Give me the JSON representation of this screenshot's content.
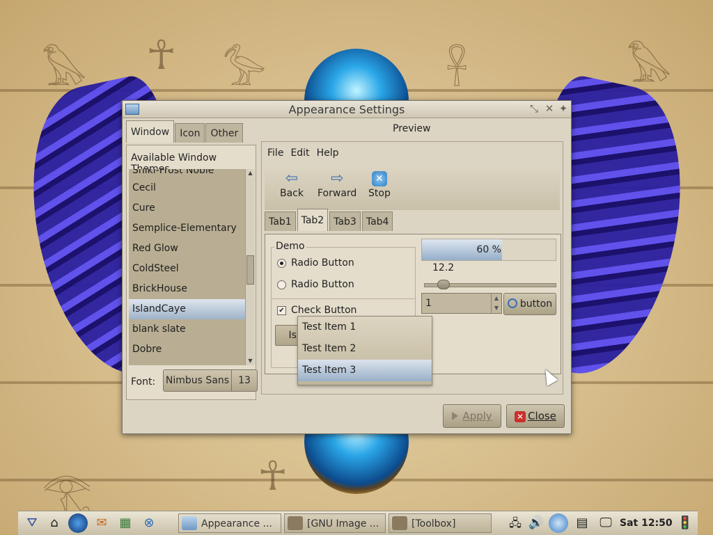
{
  "window": {
    "title": "Appearance Settings",
    "tabs": [
      {
        "label": "Window",
        "active": true
      },
      {
        "label": "Icon",
        "active": false
      },
      {
        "label": "Other",
        "active": false
      }
    ],
    "themes_heading": "Available Window Themes",
    "themes": [
      "Shiki-Frost Noble",
      "Cecil",
      "Cure",
      "Semplice-Elementary",
      "Red Glow",
      "ColdSteel",
      "BrickHouse",
      "IslandCaye",
      "blank slate",
      "Dobre"
    ],
    "selected_theme": "IslandCaye",
    "font_label": "Font:",
    "font_name": "Nimbus Sans",
    "font_size": "13",
    "apply_label": "Apply",
    "close_label": "Close"
  },
  "preview": {
    "label": "Preview",
    "menu": [
      "File",
      "Edit",
      "Help"
    ],
    "toolbar": [
      "Back",
      "Forward",
      "Stop"
    ],
    "tabs": [
      "Tab1",
      "Tab2",
      "Tab3",
      "Tab4"
    ],
    "active_tab": "Tab2",
    "demo_legend": "Demo",
    "radio1": "Radio Button",
    "radio2": "Radio Button",
    "check": "Check Button",
    "entry_value": "IslandCaye ### FINAL ###",
    "progress_text": "60 %",
    "progress_fraction": 0.6,
    "scale_value": "12.2",
    "spin_value": "1",
    "search_button": "button",
    "list_items": [
      "Test Item 1",
      "Test Item 2",
      "Test Item 3"
    ],
    "selected_item": "Test Item 3"
  },
  "taskbar": {
    "tasks": [
      "Appearance ...",
      "[GNU Image ...",
      "[Toolbox]"
    ],
    "clock": "Sat 12:50"
  },
  "colors": {
    "selection": "#9fb3c9",
    "list_bg": "#b9ae93",
    "close_badge": "#c9302c"
  }
}
